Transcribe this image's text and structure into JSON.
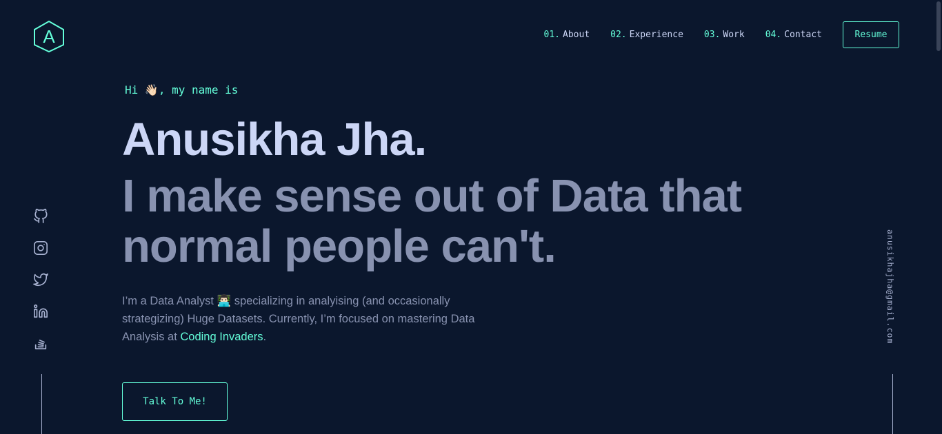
{
  "logo": {
    "letter": "A"
  },
  "nav": {
    "items": [
      {
        "num": "01.",
        "label": "About"
      },
      {
        "num": "02.",
        "label": "Experience"
      },
      {
        "num": "03.",
        "label": "Work"
      },
      {
        "num": "04.",
        "label": "Contact"
      }
    ],
    "resume_label": "Resume"
  },
  "social": {
    "icons": [
      "github-icon",
      "instagram-icon",
      "twitter-icon",
      "linkedin-icon",
      "stackoverflow-icon"
    ]
  },
  "email": "anusikhajha@gmail.com",
  "hero": {
    "greeting": "Hi 👋🏻, my name is",
    "name": "Anusikha Jha.",
    "tagline": "I make sense out of Data that normal people can't.",
    "bio_before": "I’m a Data Analyst 👨🏻‍💻 specializing in analyising (and occasionally strategizing) Huge Datasets. Currently, I’m focused on mastering Data Analysis at ",
    "bio_link": "Coding Invaders",
    "bio_after": ".",
    "cta_label": "Talk To Me!"
  },
  "colors": {
    "background": "#0b172d",
    "accent": "#64ffda",
    "heading": "#ccd6f6",
    "muted": "#8892b0"
  }
}
